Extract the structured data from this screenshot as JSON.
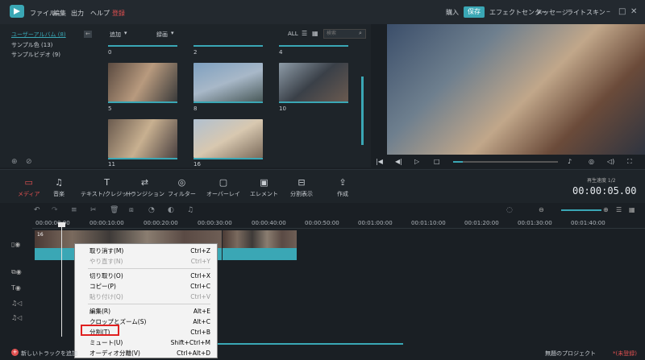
{
  "menu": {
    "file": "ファイル",
    "edit": "編集",
    "output": "出力",
    "help": "ヘルプ",
    "register": "登録"
  },
  "header": {
    "buy": "購入",
    "save": "保存",
    "effects": "エフェクトセンター",
    "message": "メッセージ",
    "light": "ライトスキン"
  },
  "albums": [
    "ユーザーアルバム (8)",
    "サンプル色 (13)",
    "サンプルビデオ (9)"
  ],
  "mediabar": {
    "import": "追加",
    "record": "録画",
    "all": "ALL",
    "search_placeholder": "検索"
  },
  "thumbs": [
    {
      "label": "0"
    },
    {
      "label": "2"
    },
    {
      "label": "4"
    },
    {
      "label": "5"
    },
    {
      "label": "8"
    },
    {
      "label": "10"
    },
    {
      "label": "11"
    },
    {
      "label": "16"
    }
  ],
  "tools": [
    "メディア",
    "音楽",
    "テキスト/クレジット",
    "トランジション",
    "フィルター",
    "オーバーレイ",
    "エレメント",
    "分割表示",
    "作成"
  ],
  "timecode": {
    "label": "再生速度  1/2",
    "value": "00:00:05.00"
  },
  "ruler": [
    "00:00:00:00",
    "00:00:10:00",
    "00:00:20:00",
    "00:00:30:00",
    "00:00:40:00",
    "00:00:50:00",
    "00:01:00:00",
    "00:01:10:00",
    "00:01:20:00",
    "00:01:30:00",
    "00:01:40:00"
  ],
  "clip_label": "16",
  "context_menu": [
    {
      "label": "取り消す(M)",
      "shortcut": "Ctrl+Z",
      "disabled": false
    },
    {
      "label": "やり直す(N)",
      "shortcut": "Ctrl+Y",
      "disabled": true
    },
    {
      "label": "切り取り(O)",
      "shortcut": "Ctrl+X",
      "disabled": false
    },
    {
      "label": "コピー(P)",
      "shortcut": "Ctrl+C",
      "disabled": false
    },
    {
      "label": "貼り付け(Q)",
      "shortcut": "Ctrl+V",
      "disabled": true
    },
    {
      "label": "編集(R)",
      "shortcut": "Alt+E",
      "disabled": false
    },
    {
      "label": "クロップとズーム(S)",
      "shortcut": "Alt+C",
      "disabled": false
    },
    {
      "label": "分割(T)",
      "shortcut": "Ctrl+B",
      "disabled": false
    },
    {
      "label": "ミュート(U)",
      "shortcut": "Shift+Ctrl+M",
      "disabled": false
    },
    {
      "label": "オーディオ分離(V)",
      "shortcut": "Ctrl+Alt+D",
      "disabled": false
    }
  ],
  "bottom": {
    "add_track": "新しいトラックを追加",
    "project": "無題のプロジェクト",
    "status": "*(未登録)"
  },
  "colors": {
    "accent": "#3aa7b5",
    "highlight": "#e02020"
  }
}
